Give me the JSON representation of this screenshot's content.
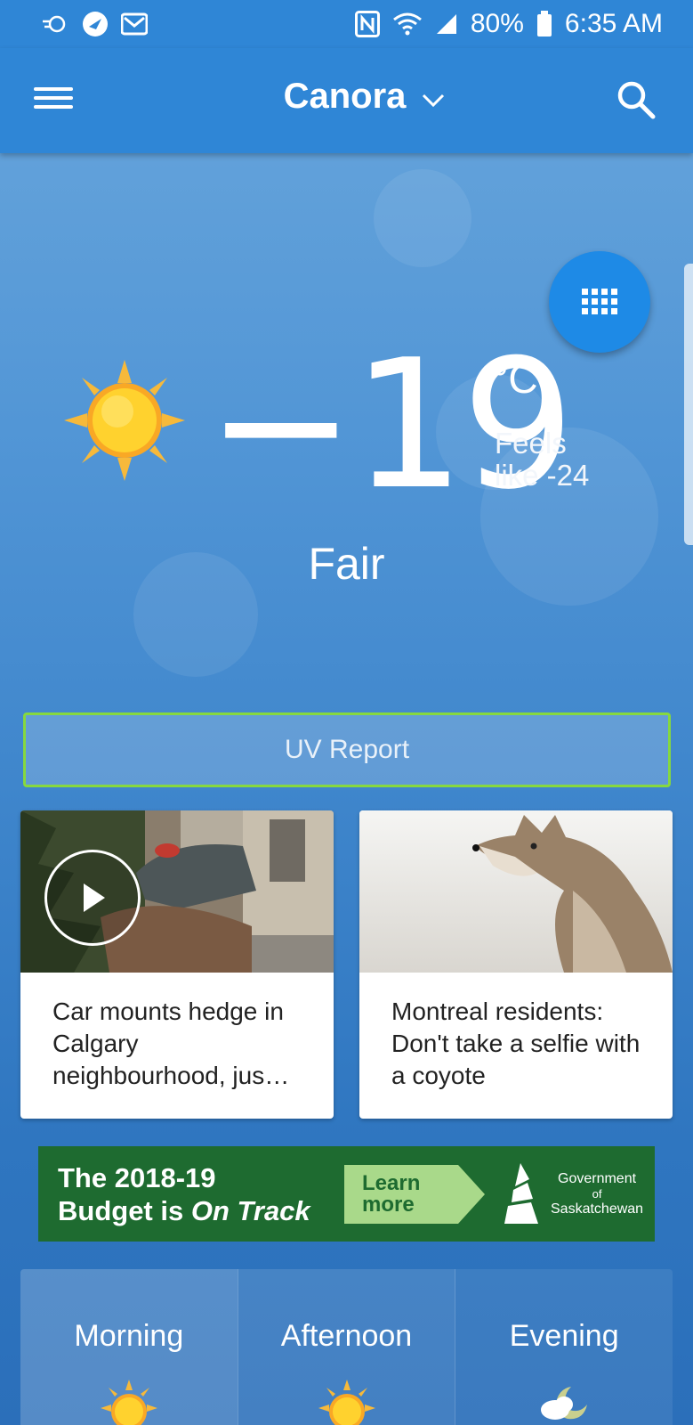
{
  "status_bar": {
    "icons_left": [
      "sync-cloud-icon",
      "navigation-icon",
      "gmail-icon"
    ],
    "icons_right": [
      "nfc-icon",
      "wifi-icon",
      "signal-icon"
    ],
    "battery": "80%",
    "time": "6:35 AM"
  },
  "app_bar": {
    "city": "Canora"
  },
  "current": {
    "temperature": "−19",
    "unit": "°C",
    "feels_like_line1": "Feels",
    "feels_like_line2": "like -24",
    "condition": "Fair"
  },
  "uv_report": {
    "label": "UV Report"
  },
  "news": [
    {
      "title": "Car mounts hedge in Calgary neighbourhood, jus…",
      "has_video": true
    },
    {
      "title": "Montreal residents: Don't take a selfie with a coyote",
      "has_video": false
    }
  ],
  "ad": {
    "line1": "The 2018-19",
    "line2_start": "Budget is ",
    "line2_emph": "On Track",
    "button_line1": "Learn",
    "button_line2": "more",
    "gov_line1": "Government",
    "gov_line2": "of",
    "gov_line3": "Saskatchewan"
  },
  "forecast": [
    {
      "label": "Morning",
      "icon": "sun-icon"
    },
    {
      "label": "Afternoon",
      "icon": "sun-icon"
    },
    {
      "label": "Evening",
      "icon": "partly-cloudy-night-icon"
    }
  ],
  "colors": {
    "app_bar": "#2f86d6",
    "fab": "#1e8ae6",
    "uv_border": "#86d83f",
    "ad_bg": "#1e6b30",
    "ad_button": "#a9d98a"
  }
}
